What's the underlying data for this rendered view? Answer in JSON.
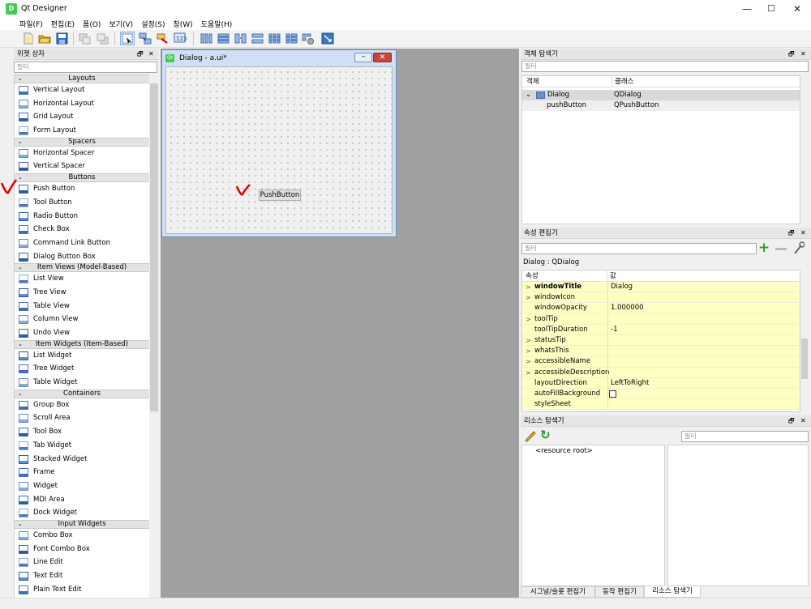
{
  "app": {
    "title": "Qt Designer",
    "icon_text": "D",
    "min": "—",
    "max": "☐",
    "close": "✕"
  },
  "menu": [
    "파일(F)",
    "편집(E)",
    "폼(O)",
    "보기(V)",
    "설정(S)",
    "창(W)",
    "도움말(H)"
  ],
  "widget_box": {
    "title": "위젯 상자",
    "filter": "필터",
    "categories": [
      {
        "name": "Layouts",
        "items": [
          "Vertical Layout",
          "Horizontal Layout",
          "Grid Layout",
          "Form Layout"
        ]
      },
      {
        "name": "Spacers",
        "items": [
          "Horizontal Spacer",
          "Vertical Spacer"
        ]
      },
      {
        "name": "Buttons",
        "items": [
          "Push Button",
          "Tool Button",
          "Radio Button",
          "Check Box",
          "Command Link Button",
          "Dialog Button Box"
        ]
      },
      {
        "name": "Item Views (Model-Based)",
        "items": [
          "List View",
          "Tree View",
          "Table View",
          "Column View",
          "Undo View"
        ]
      },
      {
        "name": "Item Widgets (Item-Based)",
        "items": [
          "List Widget",
          "Tree Widget",
          "Table Widget"
        ]
      },
      {
        "name": "Containers",
        "items": [
          "Group Box",
          "Scroll Area",
          "Tool Box",
          "Tab Widget",
          "Stacked Widget",
          "Frame",
          "Widget",
          "MDI Area",
          "Dock Widget"
        ]
      },
      {
        "name": "Input Widgets",
        "items": [
          "Combo Box",
          "Font Combo Box",
          "Line Edit",
          "Text Edit",
          "Plain Text Edit"
        ]
      }
    ]
  },
  "dialog": {
    "title": "Dialog - a.ui*",
    "button": "PushButton",
    "qt": "Qt"
  },
  "object_inspector": {
    "title": "객체 탐색기",
    "filter": "필터",
    "col_object": "객체",
    "col_class": "클래스",
    "rows": [
      {
        "object": "Dialog",
        "class": "QDialog"
      },
      {
        "object": "pushButton",
        "class": "QPushButton"
      }
    ]
  },
  "property_editor": {
    "title": "속성 편집기",
    "filter": "필터",
    "context": "Dialog : QDialog",
    "col_prop": "속성",
    "col_value": "값",
    "rows": [
      {
        "name": "windowTitle",
        "value": "Dialog",
        "chev": ">",
        "bold": true
      },
      {
        "name": "windowIcon",
        "value": "",
        "chev": ">"
      },
      {
        "name": "windowOpacity",
        "value": "1.000000",
        "chev": ""
      },
      {
        "name": "toolTip",
        "value": "",
        "chev": ">"
      },
      {
        "name": "toolTipDuration",
        "value": "-1",
        "chev": ""
      },
      {
        "name": "statusTip",
        "value": "",
        "chev": ">"
      },
      {
        "name": "whatsThis",
        "value": "",
        "chev": ">"
      },
      {
        "name": "accessibleName",
        "value": "",
        "chev": ">"
      },
      {
        "name": "accessibleDescription",
        "value": "",
        "chev": ">"
      },
      {
        "name": "layoutDirection",
        "value": "LeftToRight",
        "chev": ""
      },
      {
        "name": "autoFillBackground",
        "value": "",
        "chev": "",
        "checkbox": true
      },
      {
        "name": "styleSheet",
        "value": "",
        "chev": ""
      }
    ]
  },
  "resource_browser": {
    "title": "리소스 탐색기",
    "filter": "필터",
    "root": "<resource root>"
  },
  "bottom_tabs": [
    "시그널/슬롯 편집기",
    "동작 편집기",
    "리소스 탐색기"
  ],
  "colors": {
    "accent": "#41cd52",
    "prop_bg": "#ffffc2",
    "selection": "#cde8ff",
    "annotation": "#e00000"
  }
}
